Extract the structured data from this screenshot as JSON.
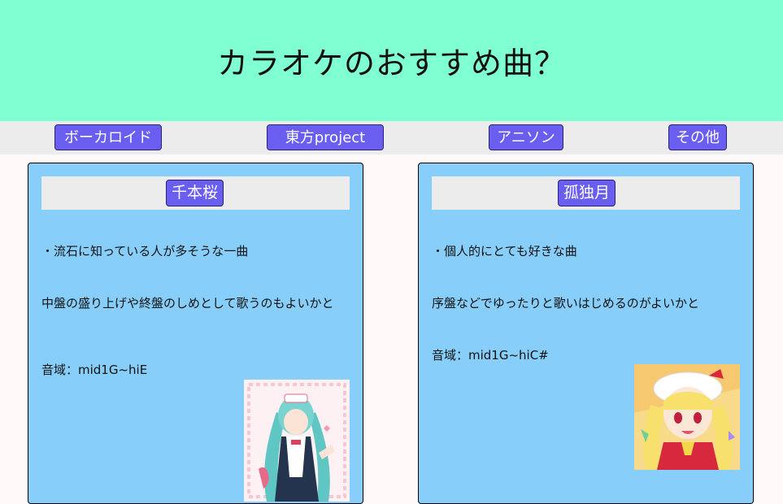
{
  "header": {
    "title": "カラオケのおすすめ曲？"
  },
  "nav": {
    "items": [
      "ボーカロイド",
      "東方project",
      "アニソン",
      "その他"
    ]
  },
  "cards": [
    {
      "title": "千本桜",
      "point": "・流石に知っている人が多そうな一曲",
      "comment": "中盤の盛り上げや終盤のしめとして歌うのもよいかと",
      "range": "音域：mid1G~hiE"
    },
    {
      "title": "孤独月",
      "point": "・個人的にとても好きな曲",
      "comment": "序盤などでゆったりと歌いはじめるのがよいかと",
      "range": "音域：mid1G~hiC#"
    }
  ]
}
